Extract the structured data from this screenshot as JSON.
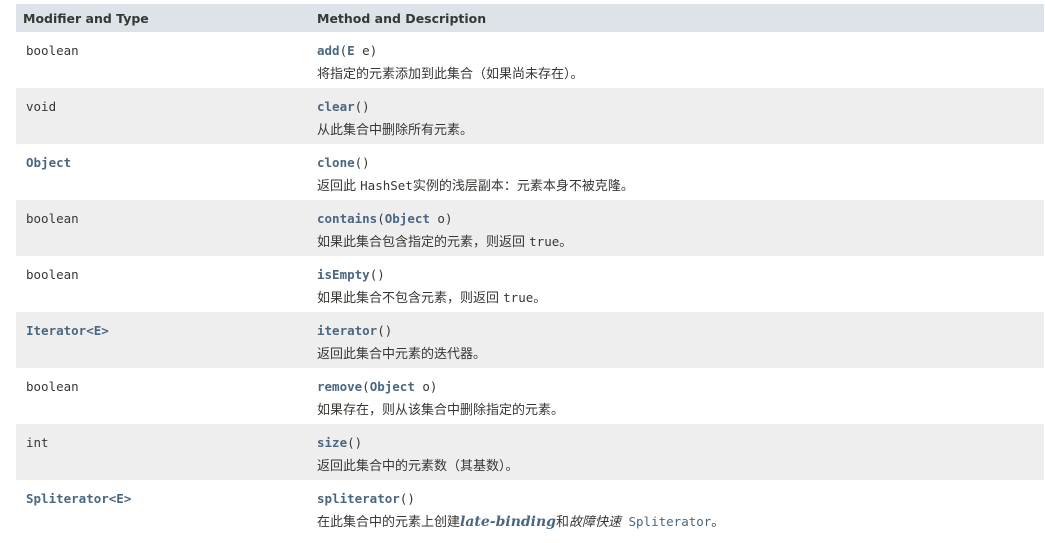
{
  "header": {
    "col1": "Modifier and Type",
    "col2": "Method and Description"
  },
  "rows": [
    {
      "type": "boolean",
      "method": "add",
      "open": "(",
      "param_type": "E",
      "param_name": " e",
      "close": ")",
      "desc": "将指定的元素添加到此集合（如果尚未存在）。"
    },
    {
      "type": "void",
      "method": "clear",
      "parens": "()",
      "desc": "从此集合中删除所有元素。"
    },
    {
      "type": "Object",
      "method": "clone",
      "parens": "()",
      "desc_pre": "返回此 ",
      "desc_code": "HashSet",
      "desc_post": "实例的浅层副本：元素本身不被克隆。"
    },
    {
      "type": "boolean",
      "method": "contains",
      "open": "(",
      "param_type": "Object",
      "param_name": " o",
      "close": ")",
      "desc_pre": "如果此集合包含指定的元素，则返回 ",
      "desc_code": "true",
      "desc_post": "。"
    },
    {
      "type": "boolean",
      "method": "isEmpty",
      "parens": "()",
      "desc_pre": "如果此集合不包含元素，则返回 ",
      "desc_code": "true",
      "desc_post": "。"
    },
    {
      "type": "Iterator<E>",
      "method": "iterator",
      "parens": "()",
      "desc": "返回此集合中元素的迭代器。"
    },
    {
      "type": "boolean",
      "method": "remove",
      "open": "(",
      "param_type": "Object",
      "param_name": " o",
      "close": ")",
      "desc": "如果存在，则从该集合中删除指定的元素。"
    },
    {
      "type": "int",
      "method": "size",
      "parens": "()",
      "desc": "返回此集合中的元素数（其基数）。"
    },
    {
      "type": "Spliterator<E>",
      "method": "spliterator",
      "parens": "()",
      "desc_pre": "在此集合中的元素上创建",
      "desc_em": "late-binding",
      "desc_mid": "和",
      "desc_it": "故障快速",
      "desc_code": " Spliterator",
      "desc_post": "。"
    }
  ],
  "colors": {
    "header_bg": "#dee3e9",
    "alt_row_bg": "#eeeeef",
    "link": "#4a6782",
    "text": "#353833"
  }
}
